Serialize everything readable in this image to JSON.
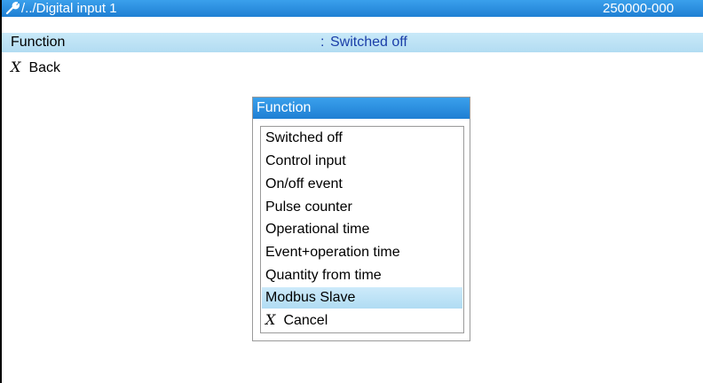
{
  "header": {
    "path": "/../Digital input 1",
    "serial": "250000-000",
    "icon": "wrench-icon"
  },
  "parameter": {
    "label": "Function",
    "colon": ":",
    "value": "Switched off"
  },
  "back": {
    "label": "Back",
    "icon": "x-icon"
  },
  "dialog": {
    "title": "Function",
    "items": [
      {
        "label": "Switched off"
      },
      {
        "label": "Control input"
      },
      {
        "label": "On/off event"
      },
      {
        "label": "Pulse counter"
      },
      {
        "label": "Operational time"
      },
      {
        "label": "Event+operation time"
      },
      {
        "label": "Quantity from time"
      },
      {
        "label": "Modbus Slave",
        "selected": true
      }
    ],
    "cancel_label": "Cancel"
  },
  "colors": {
    "title_bar": "#1f7fd3",
    "highlight_row": "#b2dcf2",
    "value_text": "#1a3ea8"
  }
}
